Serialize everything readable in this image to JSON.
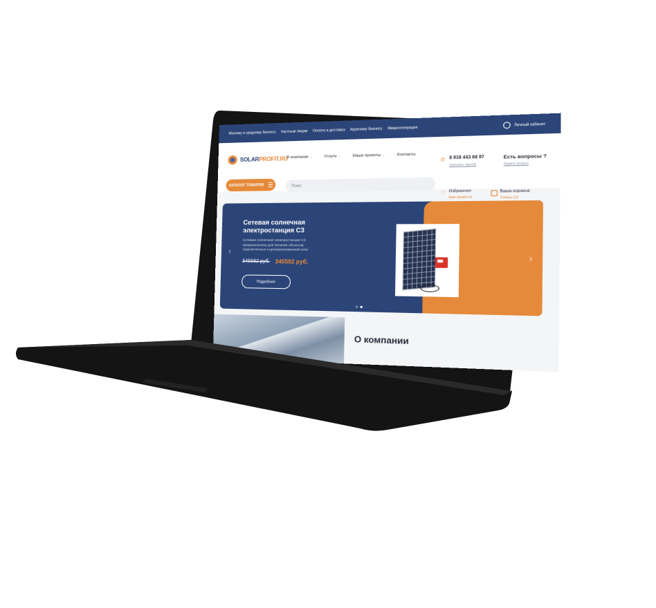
{
  "topbar": {
    "items": [
      "Малому и среднему бизнесу",
      "Частным лицам",
      "Оплата и доставка",
      "Крупному бизнесу",
      "Микрогенерация"
    ],
    "cabinet": "Личный кабинет"
  },
  "header": {
    "logo_main": "SOLAR",
    "logo_accent": "PROFIT.RU",
    "nav": [
      {
        "label": "О компании",
        "chevron": "⌄"
      },
      {
        "label": "Услуги",
        "chevron": "⌄"
      },
      {
        "label": "Наши проекты",
        "chevron": "⌄"
      },
      {
        "label": "Контакты",
        "chevron": ""
      }
    ],
    "phone": "8 918 443 68 97",
    "callback": "Заказать звонок",
    "questions_title": "Есть вопросы ?",
    "questions_link": "Задать вопрос",
    "catalog_label": "КАТАЛОГ ТОВАРОВ",
    "search_placeholder": "Поиск",
    "favorites_title": "Избранное",
    "favorites_sub": "Вам нравится",
    "cart_title": "Ваша корзина",
    "cart_sub": "Товары (0)"
  },
  "banner": {
    "title": "Сетевая солнечная электростанция С3",
    "description": "Сетевая солнечная электростанция С3 предназначена для питания объектов, подключенных к централизованной сети.",
    "old_price": "345592 руб.",
    "new_price": "345592 руб.",
    "more_label": "Подробнее",
    "slides": 2,
    "active_slide": 2
  },
  "about": {
    "title": "О компании"
  },
  "colors": {
    "primary": "#2c4578",
    "accent": "#e58a3a",
    "laptop": "#111111"
  },
  "icons": [
    "user-icon",
    "phone-icon",
    "heart-icon",
    "cart-icon",
    "burger-icon",
    "chevron-left-icon",
    "chevron-right-icon"
  ]
}
